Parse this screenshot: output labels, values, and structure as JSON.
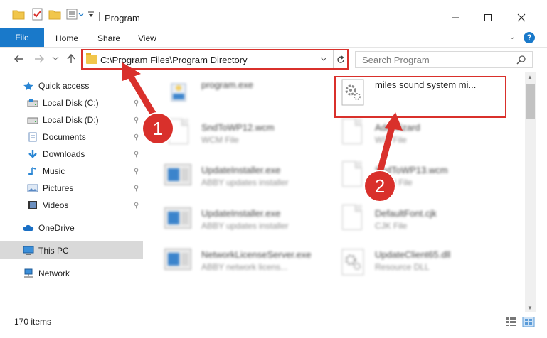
{
  "window": {
    "title": "Program",
    "controls": {
      "minimize": "—",
      "maximize": "☐",
      "close": "✕"
    }
  },
  "ribbon": {
    "file_tab": "File",
    "tabs": [
      "Home",
      "Share",
      "View"
    ],
    "help": "?"
  },
  "address": {
    "path": "C:\\Program Files\\Program Directory",
    "search_placeholder": "Search Program"
  },
  "sidebar": {
    "quick_access": "Quick access",
    "items": [
      {
        "label": "Local Disk (C:)",
        "icon": "drive-icon",
        "pinned": true
      },
      {
        "label": "Local Disk (D:)",
        "icon": "drive-icon",
        "pinned": true
      },
      {
        "label": "Documents",
        "icon": "documents-icon",
        "pinned": true
      },
      {
        "label": "Downloads",
        "icon": "downloads-icon",
        "pinned": true
      },
      {
        "label": "Music",
        "icon": "music-icon",
        "pinned": true
      },
      {
        "label": "Pictures",
        "icon": "pictures-icon",
        "pinned": true
      },
      {
        "label": "Videos",
        "icon": "videos-icon",
        "pinned": true
      }
    ],
    "onedrive": "OneDrive",
    "this_pc": "This PC",
    "network": "Network"
  },
  "files": [
    {
      "name": "program.exe",
      "type": "",
      "icon": "exe-icon",
      "blurred": true
    },
    {
      "name": "miles sound system mi...",
      "type": "",
      "icon": "dll-gear-icon",
      "blurred": false,
      "selected": true
    },
    {
      "name": "SndToWP12.wcm",
      "type": "WCM File",
      "icon": "document-icon",
      "blurred": true
    },
    {
      "name": "AddWizard",
      "type": "WIZ File",
      "icon": "document-icon",
      "blurred": true
    },
    {
      "name": "UpdateInstaller.exe",
      "type": "ABBY updates installer",
      "icon": "app-icon",
      "blurred": true
    },
    {
      "name": "SndToWP13.wcm",
      "type": "WCM File",
      "icon": "document-icon",
      "blurred": true
    },
    {
      "name": "UpdateInstaller.exe",
      "type": "ABBY updates installer",
      "icon": "app-icon",
      "blurred": true
    },
    {
      "name": "DefaultFont.cjk",
      "type": "CJK File",
      "icon": "document-icon",
      "blurred": true
    },
    {
      "name": "NetworkLicenseServer.exe",
      "type": "ABBY network licens...",
      "icon": "app-icon",
      "blurred": true
    },
    {
      "name": "UpdateClient65.dll",
      "type": "Resource DLL",
      "icon": "dll-gear-icon",
      "blurred": true
    }
  ],
  "status": {
    "item_count": "170 items"
  },
  "annotations": {
    "step1": "1",
    "step2": "2",
    "color": "#d9302b"
  }
}
